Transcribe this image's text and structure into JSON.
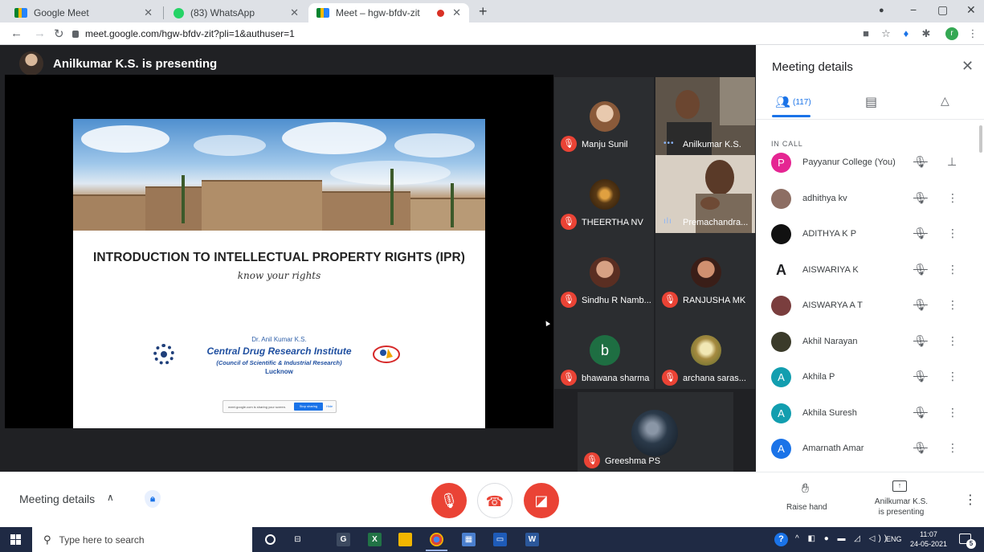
{
  "browser": {
    "tabs": [
      {
        "title": "Google Meet"
      },
      {
        "title": "(83) WhatsApp"
      },
      {
        "title": "Meet – hgw-bfdv-zit"
      }
    ],
    "url": "meet.google.com/hgw-bfdv-zit?pli=1&authuser=1",
    "profile_initial": "r"
  },
  "stage": {
    "presenter_label": "Anilkumar K.S. is presenting",
    "slide": {
      "title": "INTRODUCTION TO INTELLECTUAL PROPERTY RIGHTS (IPR)",
      "subtitle": "know your rights",
      "author": "Dr. Anil Kumar K.S.",
      "institute": "Central Drug Research Institute",
      "council": "(Council of Scientific & Industrial Research)",
      "city": "Lucknow",
      "share_notice": "meet.google.com is sharing your screen.",
      "stop_sharing": "Stop sharing",
      "hide": "Hide"
    }
  },
  "tiles": [
    {
      "name": "Manju Sunil",
      "avatar_color": "#c8a38a",
      "muted": true
    },
    {
      "name": "Anilkumar K.S.",
      "video": true,
      "muted": false
    },
    {
      "name": "THEERTHA NV",
      "avatar_color": "#6b4a22",
      "muted": true
    },
    {
      "name": "Premachandra...",
      "video": true,
      "muted": false
    },
    {
      "name": "Sindhu R Namb...",
      "avatar_color": "#b57e5e",
      "muted": true
    },
    {
      "name": "RANJUSHA MK",
      "avatar_color": "#a0705b",
      "muted": true
    },
    {
      "name": "bhawana sharma",
      "initial": "b",
      "avatar_color": "#1e6e42",
      "muted": true
    },
    {
      "name": "archana saras...",
      "avatar_color": "#b9a46d",
      "muted": true
    },
    {
      "name": "Greeshma PS",
      "avatar_color": "#2b3a4a",
      "muted": true
    }
  ],
  "panel": {
    "title": "Meeting details",
    "people_count": "(117)",
    "section_label": "IN CALL",
    "participants": [
      {
        "name": "Payyanur College (You)",
        "initial": "P",
        "color": "#e52592",
        "action": "pin"
      },
      {
        "name": "adhithya kv",
        "initial": "",
        "color": "#8d6e63",
        "action": "more"
      },
      {
        "name": "ADITHYA K P",
        "initial": "",
        "color": "#111111",
        "action": "more"
      },
      {
        "name": "AISWARIYA K",
        "initial": "A",
        "color": "#ffffff",
        "action": "more"
      },
      {
        "name": "AISWARYA A T",
        "initial": "",
        "color": "#7a3e3e",
        "action": "more"
      },
      {
        "name": "Akhil Narayan",
        "initial": "",
        "color": "#3b3b2a",
        "action": "more"
      },
      {
        "name": "Akhila P",
        "initial": "A",
        "color": "#129eaf",
        "action": "more"
      },
      {
        "name": "Akhila Suresh",
        "initial": "A",
        "color": "#129eaf",
        "action": "more"
      },
      {
        "name": "Amarnath Amar",
        "initial": "A",
        "color": "#1a73e8",
        "action": "more"
      }
    ]
  },
  "controls": {
    "meeting_details": "Meeting details",
    "raise_hand": "Raise hand",
    "presenting_line1": "Anilkumar K.S.",
    "presenting_line2": "is presenting"
  },
  "taskbar": {
    "search_placeholder": "Type here to search",
    "lang": "ENG",
    "time": "11:07",
    "date": "24-05-2021",
    "notification_count": "5"
  }
}
